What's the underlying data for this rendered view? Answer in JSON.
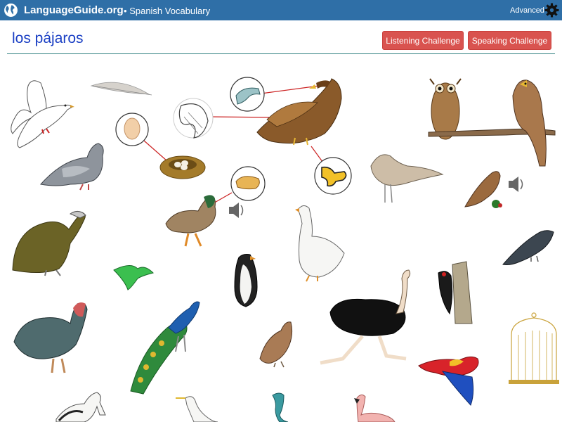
{
  "header": {
    "brand_main": "LanguageGuide",
    "brand_tld": ".org",
    "separator": "•",
    "section": "Spanish Vocabulary",
    "mode_label": "Advanced",
    "icons": [
      "globe-icon",
      "gear-icon"
    ]
  },
  "page": {
    "title": "los pájaros",
    "listening_button": "Listening Challenge",
    "speaking_button": "Speaking Challenge"
  },
  "colors": {
    "topbar": "#2f6fa7",
    "title": "#1a3fc4",
    "button": "#d9534f",
    "divider": "#2e7f7f",
    "pointer_line": "#cc2222"
  },
  "items": [
    "dove",
    "feather",
    "wing",
    "egg",
    "nest",
    "bill",
    "eagle",
    "talon",
    "owl",
    "hawk",
    "pigeon",
    "sparrow",
    "duck",
    "duck-bill",
    "goose",
    "vulture",
    "hummingbird",
    "penguin",
    "crow",
    "ostrich",
    "woodpecker",
    "turkey",
    "peacock",
    "quail",
    "parrot",
    "birdcage",
    "pelican",
    "egret",
    "heron",
    "flamingo"
  ]
}
